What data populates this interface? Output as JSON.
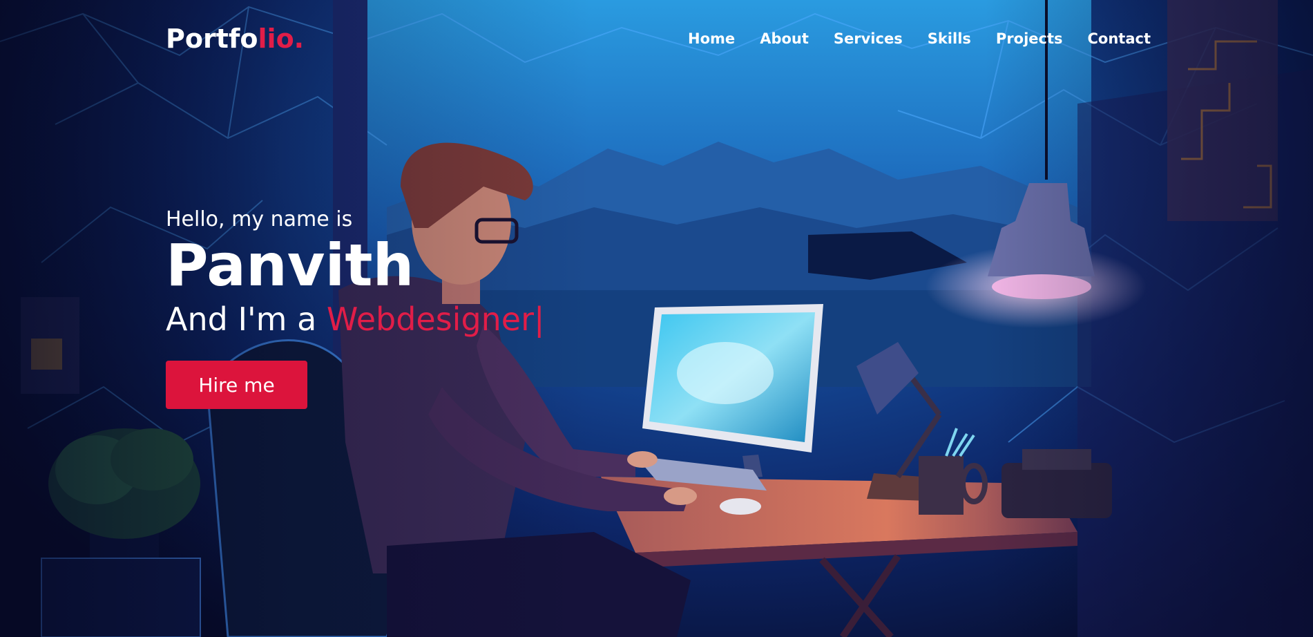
{
  "nav": {
    "logo_main": "Portfo",
    "logo_accent": "lio.",
    "links": [
      "Home",
      "About",
      "Services",
      "Skills",
      "Projects",
      "Contact"
    ]
  },
  "hero": {
    "greeting": "Hello, my name is",
    "name": "Panvith",
    "role_prefix": "And I'm a",
    "role": "Webdesigner",
    "cursor": "|",
    "cta_label": "Hire me"
  },
  "colors": {
    "accent": "#dc143c",
    "text": "#ffffff",
    "background": "#0d2668"
  },
  "background": {
    "icon": "developer-at-desk-illustration"
  }
}
